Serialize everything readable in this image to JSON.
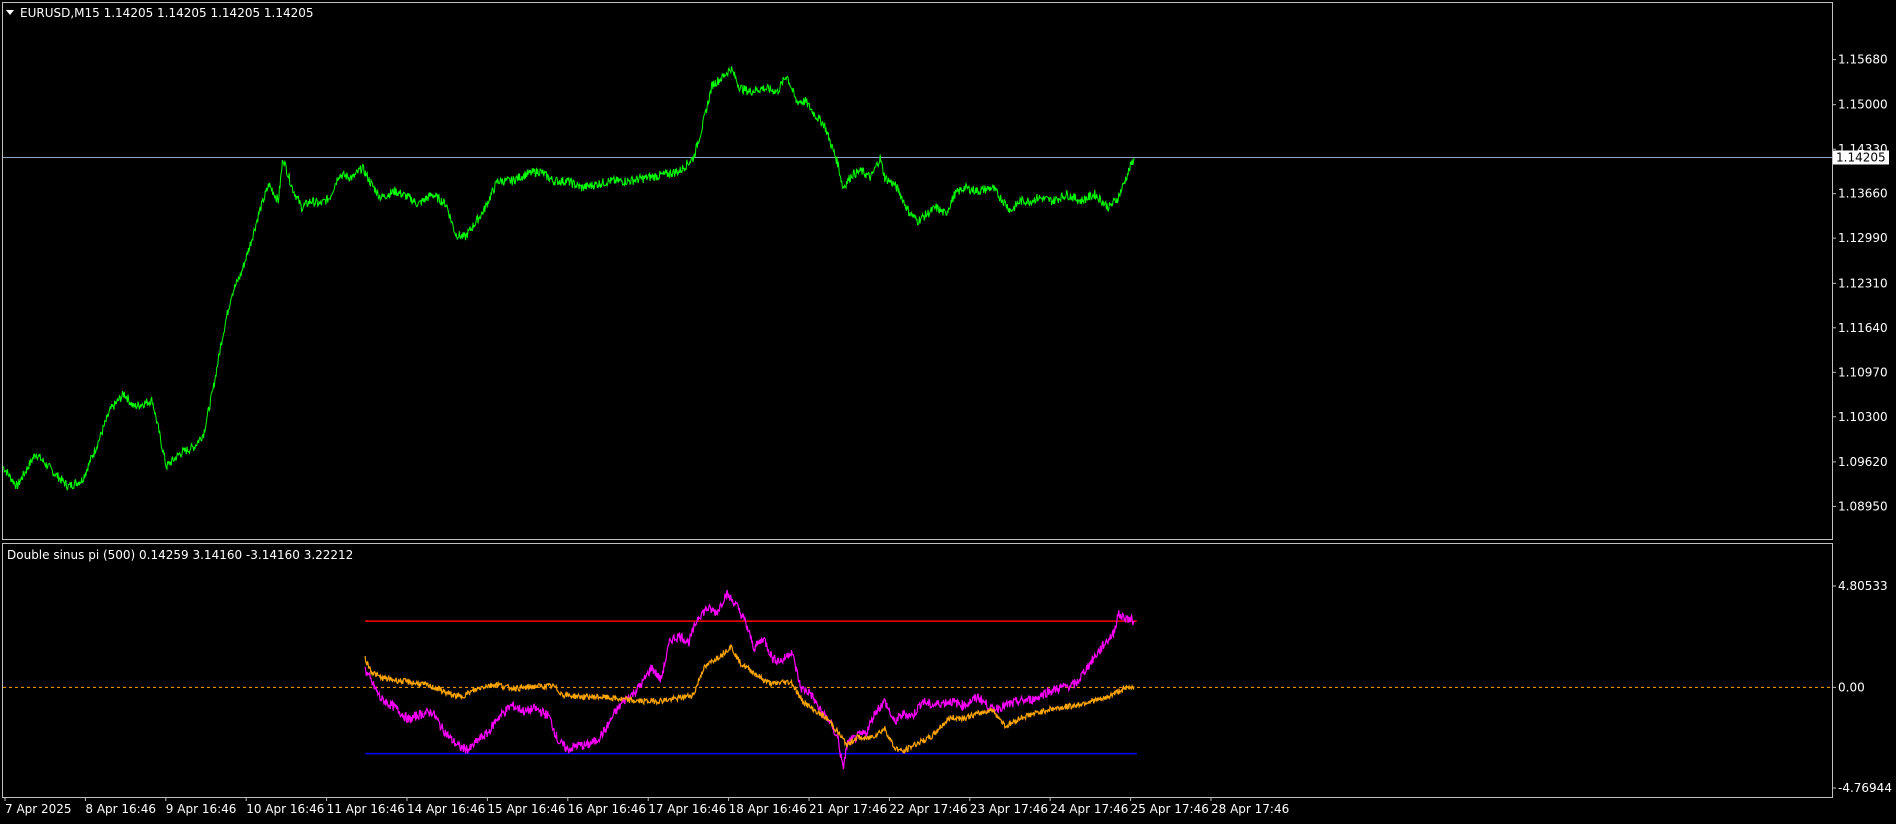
{
  "colors": {
    "background": "#000000",
    "frame": "#c0c0c0",
    "text": "#ffffff",
    "price_line": "#00ff00",
    "bid_line": "#8ea6bf",
    "series1": "#ff00ff",
    "series2": "#ffa500",
    "upper_level": "#ff0000",
    "lower_level": "#0000ff",
    "zero_level": "#ffa500"
  },
  "chart_data": [
    {
      "type": "line",
      "title": "EURUSD,M15  1.14205 1.14205 1.14205 1.14205",
      "symbol": "EURUSD",
      "timeframe": "M15",
      "ohlc": [
        1.14205,
        1.14205,
        1.14205,
        1.14205
      ],
      "current_price": 1.14205,
      "current_price_label": "1.14205",
      "y_ticks": [
        "1.15680",
        "1.15000",
        "1.14330",
        "1.13660",
        "1.12990",
        "1.12310",
        "1.11640",
        "1.10970",
        "1.10300",
        "1.09620",
        "1.08950"
      ],
      "ylim": [
        1.087,
        1.1608
      ],
      "x_ticks": [
        "7 Apr 2025",
        "8 Apr 16:46",
        "9 Apr 16:46",
        "10 Apr 16:46",
        "11 Apr 16:46",
        "14 Apr 16:46",
        "15 Apr 16:46",
        "16 Apr 16:46",
        "17 Apr 16:46",
        "18 Apr 16:46",
        "21 Apr 17:46",
        "22 Apr 17:46",
        "23 Apr 17:46",
        "24 Apr 17:46",
        "25 Apr 17:46",
        "28 Apr 17:46"
      ],
      "x_range": [
        0,
        1960
      ],
      "grid": false,
      "series": [
        {
          "key": "EURUSD close",
          "x": [
            0,
            15,
            35,
            55,
            70,
            85,
            100,
            115,
            130,
            140,
            160,
            175,
            190,
            205,
            215,
            225,
            235,
            245,
            255,
            265,
            275,
            285,
            295,
            300,
            310,
            320,
            330,
            340,
            350,
            360,
            375,
            385,
            395,
            405,
            420,
            435,
            445,
            460,
            475,
            485,
            495,
            505,
            515,
            530,
            545,
            560,
            575,
            590,
            605,
            620,
            635,
            650,
            670,
            690,
            710,
            725,
            740,
            750,
            760,
            770,
            780,
            790,
            800,
            815,
            830,
            840,
            850,
            860,
            870,
            880,
            885,
            890,
            895,
            900,
            910,
            920,
            930,
            940,
            945,
            955,
            960,
            970,
            980,
            990,
            1000,
            1010,
            1020,
            1030,
            1045,
            1060,
            1075,
            1080,
            1090,
            1100,
            1110,
            1125,
            1140,
            1155,
            1170,
            1185,
            1195,
            1205,
            1212
          ],
          "y": [
            1.0955,
            1.0925,
            1.0975,
            1.0945,
            1.0925,
            1.0935,
            1.0985,
            1.104,
            1.1065,
            1.1045,
            1.1055,
            1.0955,
            1.0975,
            1.0985,
            1.1005,
            1.107,
            1.115,
            1.1215,
            1.1245,
            1.129,
            1.134,
            1.138,
            1.1355,
            1.142,
            1.1375,
            1.1345,
            1.1355,
            1.135,
            1.136,
            1.1395,
            1.139,
            1.1405,
            1.138,
            1.136,
            1.137,
            1.136,
            1.135,
            1.1365,
            1.135,
            1.1305,
            1.13,
            1.132,
            1.134,
            1.1385,
            1.1385,
            1.1395,
            1.14,
            1.1385,
            1.1385,
            1.1375,
            1.138,
            1.1385,
            1.1385,
            1.139,
            1.1395,
            1.14,
            1.142,
            1.147,
            1.153,
            1.154,
            1.1555,
            1.1525,
            1.152,
            1.1525,
            1.152,
            1.1545,
            1.1505,
            1.1505,
            1.1485,
            1.147,
            1.145,
            1.143,
            1.141,
            1.1375,
            1.1395,
            1.14,
            1.139,
            1.142,
            1.139,
            1.138,
            1.137,
            1.134,
            1.1325,
            1.1335,
            1.1345,
            1.1335,
            1.1365,
            1.1375,
            1.137,
            1.1375,
            1.135,
            1.134,
            1.1355,
            1.1355,
            1.136,
            1.1355,
            1.1365,
            1.1355,
            1.1365,
            1.1345,
            1.136,
            1.1395,
            1.142
          ],
          "color": "#00ff00"
        }
      ]
    },
    {
      "type": "line",
      "title": "Double sinus pi (500) 0.14259 3.14160 -3.14160 3.22212",
      "indicator_name": "Double sinus pi (500)",
      "indicator_values": [
        0.14259,
        3.1416,
        -3.1416,
        3.22212
      ],
      "y_ticks": [
        "4.80533",
        "0.00",
        "-4.76944"
      ],
      "ylim": [
        -4.76944,
        4.80533
      ],
      "x_range": [
        0,
        1960
      ],
      "levels": [
        3.1416,
        0.0,
        -3.1416
      ],
      "grid": false,
      "series": [
        {
          "key": "Line 1",
          "x": [
            388,
            395,
            405,
            420,
            435,
            445,
            460,
            470,
            480,
            490,
            500,
            510,
            520,
            530,
            545,
            560,
            570,
            585,
            595,
            605,
            615,
            625,
            635,
            645,
            655,
            665,
            675,
            685,
            695,
            705,
            715,
            725,
            735,
            745,
            755,
            765,
            775,
            785,
            795,
            805,
            815,
            825,
            835,
            845,
            855,
            865,
            875,
            885,
            895,
            900,
            905,
            915,
            925,
            935,
            945,
            955,
            965,
            975,
            985,
            995,
            1005,
            1015,
            1030,
            1045,
            1060,
            1075,
            1090,
            1105,
            1120,
            1135,
            1150,
            1160,
            1170,
            1180,
            1190,
            1195,
            1205,
            1212
          ],
          "y": [
            0.85,
            0.25,
            -0.55,
            -0.95,
            -1.55,
            -1.3,
            -1.15,
            -1.9,
            -2.45,
            -2.85,
            -2.95,
            -2.45,
            -2.15,
            -1.45,
            -0.85,
            -1.15,
            -1.0,
            -1.35,
            -2.55,
            -2.95,
            -2.75,
            -2.75,
            -2.55,
            -2.05,
            -1.25,
            -0.65,
            -0.3,
            0.2,
            0.95,
            0.35,
            2.25,
            2.45,
            2.15,
            3.35,
            3.75,
            3.55,
            4.45,
            3.95,
            3.15,
            1.85,
            2.35,
            1.35,
            1.25,
            1.75,
            -0.05,
            -0.25,
            -1.05,
            -1.55,
            -2.45,
            -3.85,
            -2.65,
            -2.35,
            -2.15,
            -1.15,
            -0.65,
            -1.65,
            -1.25,
            -1.35,
            -0.65,
            -0.85,
            -0.75,
            -0.65,
            -0.85,
            -0.45,
            -1.05,
            -0.85,
            -0.65,
            -0.55,
            -0.2,
            0.0,
            0.15,
            0.85,
            1.45,
            2.05,
            2.55,
            3.45,
            3.25,
            3.15
          ],
          "color": "#ff00ff"
        },
        {
          "key": "Line 2",
          "x": [
            388,
            395,
            405,
            420,
            435,
            450,
            465,
            480,
            490,
            500,
            515,
            530,
            540,
            555,
            570,
            590,
            600,
            620,
            640,
            660,
            680,
            700,
            720,
            740,
            750,
            760,
            770,
            780,
            790,
            800,
            815,
            825,
            835,
            845,
            855,
            865,
            875,
            885,
            895,
            905,
            915,
            925,
            935,
            945,
            955,
            965,
            975,
            985,
            995,
            1005,
            1015,
            1030,
            1045,
            1060,
            1075,
            1090,
            1105,
            1120,
            1135,
            1150,
            1165,
            1180,
            1190,
            1200,
            1212
          ],
          "y": [
            1.35,
            0.75,
            0.45,
            0.35,
            0.25,
            0.15,
            -0.05,
            -0.35,
            -0.45,
            -0.25,
            0.05,
            0.15,
            0.0,
            -0.05,
            0.05,
            0.05,
            -0.35,
            -0.45,
            -0.45,
            -0.55,
            -0.65,
            -0.65,
            -0.55,
            -0.35,
            0.85,
            1.25,
            1.55,
            1.95,
            1.15,
            0.85,
            0.35,
            0.15,
            0.25,
            0.25,
            -0.55,
            -0.95,
            -1.25,
            -1.55,
            -2.15,
            -2.75,
            -2.35,
            -2.45,
            -2.25,
            -1.95,
            -2.85,
            -3.05,
            -2.75,
            -2.55,
            -2.35,
            -1.85,
            -1.45,
            -1.45,
            -1.25,
            -1.05,
            -1.85,
            -1.45,
            -1.25,
            -1.05,
            -0.95,
            -0.85,
            -0.65,
            -0.55,
            -0.3,
            -0.1,
            0.05
          ],
          "color": "#ffa500"
        }
      ]
    }
  ]
}
